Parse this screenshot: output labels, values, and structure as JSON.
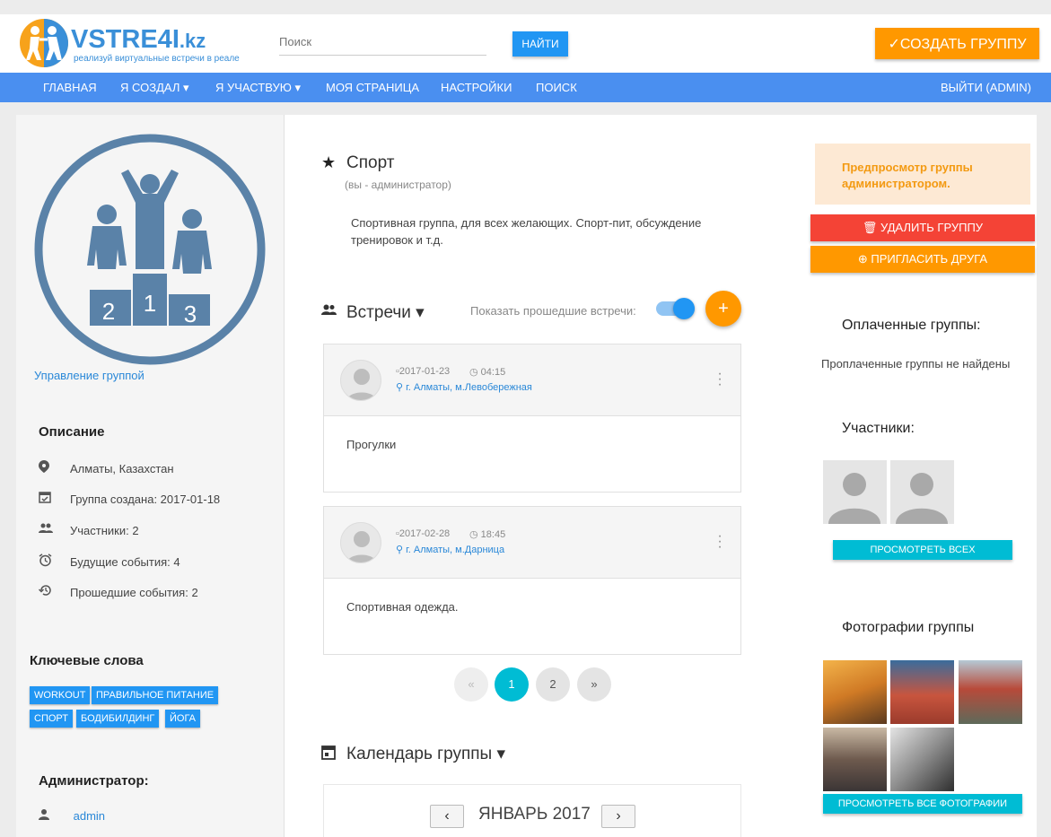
{
  "header": {
    "logo_main": "VSTRE4I",
    "logo_tld": ".kz",
    "logo_tagline": "реализуй виртуальные встречи в реале",
    "search_placeholder": "Поиск",
    "find_label": "НАЙТИ",
    "create_label": "✓СОЗДАТЬ ГРУППУ"
  },
  "nav": {
    "items": [
      "ГЛАВНАЯ",
      "Я СОЗДАЛ ▾",
      "Я УЧАСТВУЮ ▾",
      "МОЯ СТРАНИЦА",
      "НАСТРОЙКИ",
      "ПОИСК"
    ],
    "logout": "ВЫЙТИ (ADMIN)"
  },
  "left": {
    "manage_link": "Управление группой",
    "description_heading": "Описание",
    "info": [
      {
        "icon": "location-icon",
        "text": "Алматы, Казахстан"
      },
      {
        "icon": "calendar-check-icon",
        "text": "Группа создана: 2017-01-18"
      },
      {
        "icon": "people-icon",
        "text": "Участники: 2"
      },
      {
        "icon": "alarm-icon",
        "text": "Будущие события: 4"
      },
      {
        "icon": "history-icon",
        "text": "Прошедшие события: 2"
      }
    ],
    "keywords_heading": "Ключевые слова",
    "tags": [
      "WORKOUT",
      "ПРАВИЛЬНОЕ ПИТАНИЕ",
      "СПОРТ",
      "БОДИБИЛДИНГ",
      "ЙОГА"
    ],
    "admin_heading": "Администратор:",
    "admin_name": "admin"
  },
  "center": {
    "group_name": "Спорт",
    "group_role": "(вы - администратор)",
    "group_desc": "Спортивная группа, для всех желающих. Спорт-пит, обсуждение тренировок и т.д.",
    "meetings_title": "Встречи ▾",
    "show_past_label": "Показать прошедшие встречи:",
    "add_label": "+",
    "meetings": [
      {
        "date": "2017-01-23",
        "time": "04:15",
        "location": "г. Алматы, м.Левобережная",
        "text": "Прогулки"
      },
      {
        "date": "2017-02-28",
        "time": "18:45",
        "location": "г. Алматы, м.Дарница",
        "text": "Спортивная одежда."
      }
    ],
    "pagination": {
      "prev": "«",
      "pages": [
        "1",
        "2"
      ],
      "next": "»",
      "active": "1"
    },
    "calendar_title": "Календарь группы ▾",
    "calendar_month": "ЯНВАРЬ 2017",
    "calendar_prev": "‹",
    "calendar_next": "›"
  },
  "right": {
    "preview_text": "Предпросмотр группы администратором.",
    "delete_label": "🗑 УДАЛИТЬ ГРУППУ",
    "invite_label": "⊕ ПРИГЛАСИТЬ ДРУГА",
    "paid_heading": "Оплаченные группы:",
    "paid_empty": "Проплаченные группы не найдены",
    "members_heading": "Участники:",
    "view_all_label": "ПРОСМОТРЕТЬ ВСЕХ",
    "photos_heading": "Фотографии группы",
    "view_all_photos_label": "ПРОСМОТРЕТЬ ВСЕ ФОТОГРАФИИ"
  },
  "colors": {
    "brand_blue": "#4a8ff0",
    "accent_orange": "#ff9800",
    "danger_red": "#f44336",
    "teal": "#00bcd4",
    "link_blue": "#2a88d8"
  }
}
